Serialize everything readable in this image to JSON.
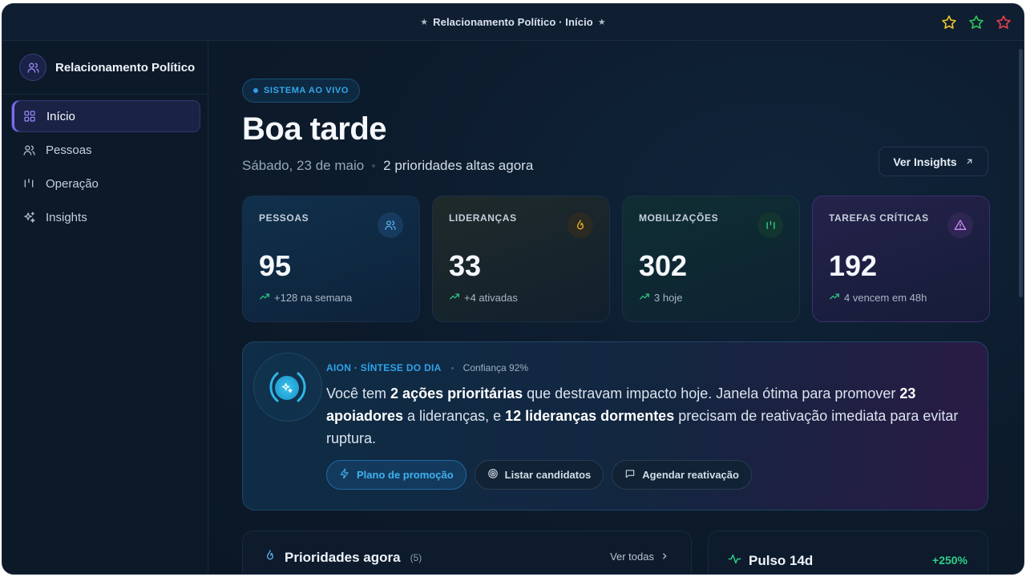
{
  "window": {
    "title": "Relacionamento Político · Início"
  },
  "colors": {
    "accent": "#2f9fe6",
    "purple": "#7b6cf0",
    "positive": "#2fd08a",
    "window_star_yellow": "#e8c12a",
    "window_star_green": "#2ec45a",
    "window_star_red": "#e3404f"
  },
  "sidebar": {
    "brand": {
      "name": "Relacionamento Político",
      "icon": "users-icon"
    },
    "items": [
      {
        "label": "Início",
        "icon": "grid-icon",
        "active": true
      },
      {
        "label": "Pessoas",
        "icon": "users-icon",
        "active": false
      },
      {
        "label": "Operação",
        "icon": "bars-icon",
        "active": false
      },
      {
        "label": "Insights",
        "icon": "sparkles-icon",
        "active": false
      }
    ]
  },
  "header": {
    "badge": "SISTEMA AO VIVO",
    "greeting": "Boa tarde",
    "date": "Sábado, 23 de maio",
    "priorities": "2 prioridades altas agora",
    "insights_button": "Ver Insights"
  },
  "stats": [
    {
      "label": "PESSOAS",
      "value": "95",
      "delta": "+128 na semana",
      "icon": "users-icon"
    },
    {
      "label": "LIDERANÇAS",
      "value": "33",
      "delta": "+4 ativadas",
      "icon": "flame-icon"
    },
    {
      "label": "MOBILIZAÇÕES",
      "value": "302",
      "delta": "3 hoje",
      "icon": "bars-icon"
    },
    {
      "label": "TAREFAS CRÍTICAS",
      "value": "192",
      "delta": "4 vencem em 48h",
      "icon": "warning-icon"
    }
  ],
  "aion": {
    "tag": "AION · SÍNTESE DO DIA",
    "confidence": "Confiança 92%",
    "text": {
      "p1": "Você tem ",
      "b1": "2 ações prioritárias",
      "p2": " que destravam impacto hoje. Janela ótima para promover ",
      "b2": "23 apoiadores",
      "p3": " a lideranças, e ",
      "b3": "12 lideranças dormentes",
      "p4": " precisam de reativação imediata para evitar ruptura."
    },
    "actions": [
      {
        "label": "Plano de promoção",
        "icon": "bolt-icon"
      },
      {
        "label": "Listar candidatos",
        "icon": "target-icon"
      },
      {
        "label": "Agendar reativação",
        "icon": "message-icon"
      }
    ]
  },
  "priorities_panel": {
    "title": "Prioridades agora",
    "count": "(5)",
    "see_all": "Ver todas"
  },
  "pulse_panel": {
    "title": "Pulso 14d",
    "value": "+250%"
  }
}
